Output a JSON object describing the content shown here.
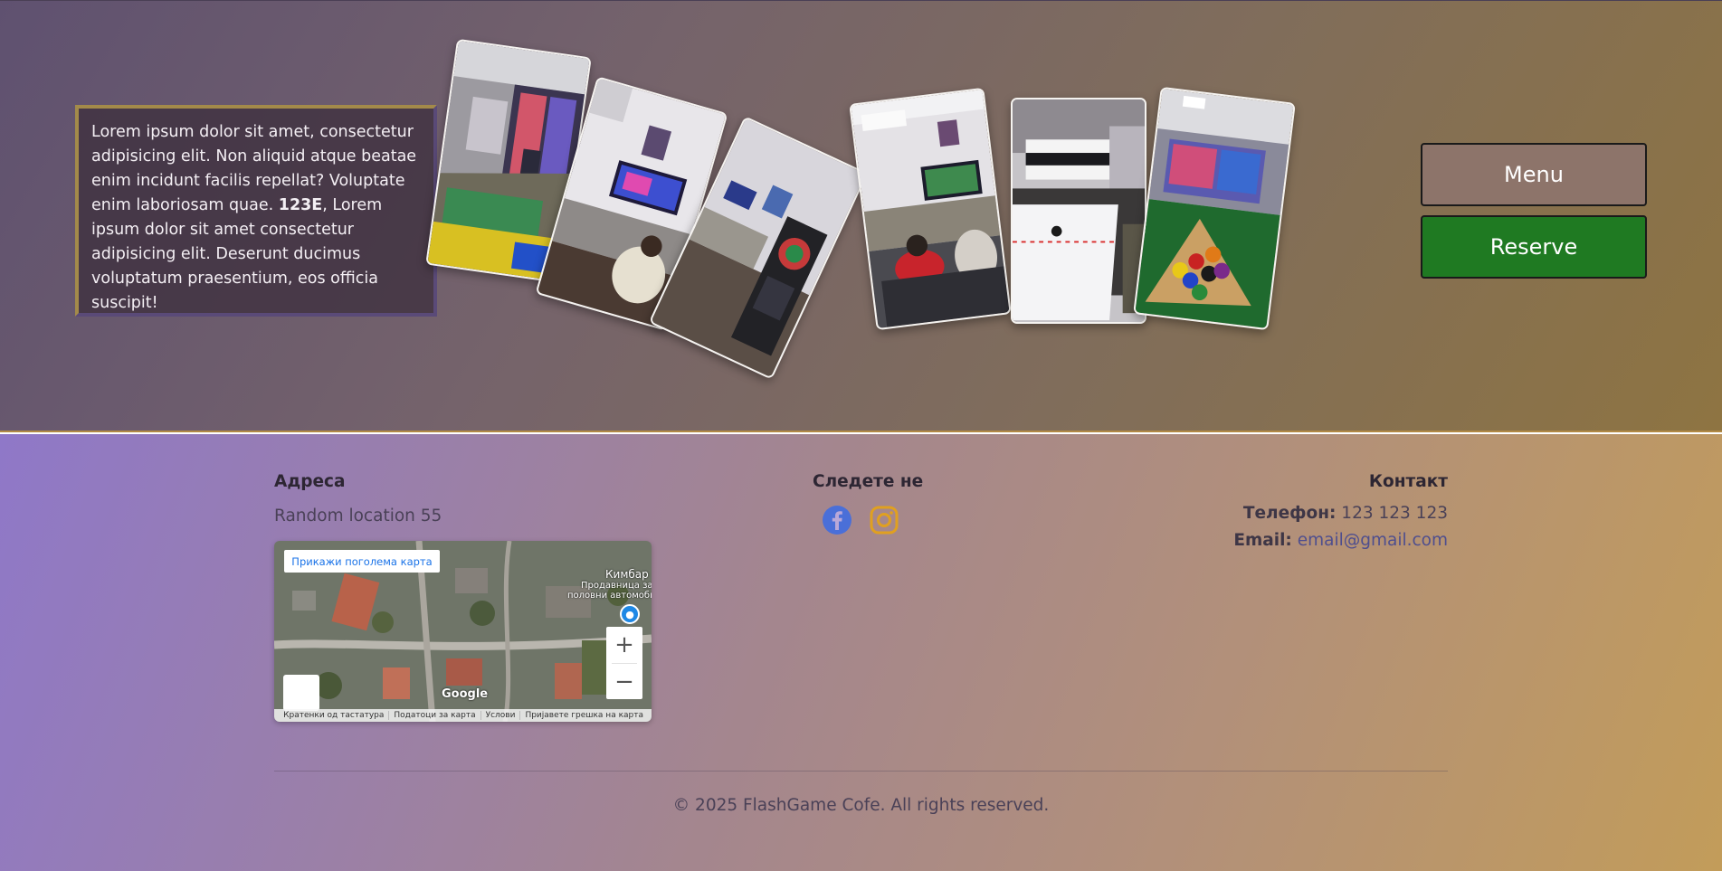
{
  "hero": {
    "intro_pre": "Lorem ipsum dolor sit amet, consectetur adipisicing elit. Non aliquid atque beatae enim incidunt facilis repellat? Voluptate enim laboriosam quae. ",
    "intro_bold": "123E",
    "intro_post": ", Lorem ipsum dolor sit amet consectetur adipisicing elit. Deserunt ducimus voluptatum praesentium, eos officia suscipit!",
    "gallery": [
      {
        "name": "photo-foosball-room"
      },
      {
        "name": "photo-gaming-tv"
      },
      {
        "name": "photo-darts-machine"
      },
      {
        "name": "photo-players-watching-tv"
      },
      {
        "name": "photo-air-hockey-table"
      },
      {
        "name": "photo-billiard-balls"
      }
    ],
    "menu_label": "Menu",
    "reserve_label": "Reserve"
  },
  "footer": {
    "address": {
      "title": "Адреса",
      "text": "Random location 55",
      "map": {
        "larger_map_link": "Прикажи поголема карта",
        "label_1": "Кимбар",
        "label_2": "Продавница за",
        "label_3": "половни автомобили",
        "google_logo": "Google",
        "bottom_links": [
          "Кратенки од тастатура",
          "Податоци за карта",
          "Услови",
          "Пријавете грешка на карта"
        ]
      }
    },
    "follow": {
      "title": "Следете не",
      "icons": [
        "facebook-icon",
        "instagram-icon"
      ],
      "facebook_color": "#4a6fd8",
      "instagram_color": "#e0a020"
    },
    "contact": {
      "title": "Контакт",
      "phone_label": "Телефон:",
      "phone_value": "123 123 123",
      "email_label": "Email:",
      "email_value": "email@gmail.com"
    },
    "copyright": "© 2025 FlashGame Cofe. All rights reserved."
  }
}
